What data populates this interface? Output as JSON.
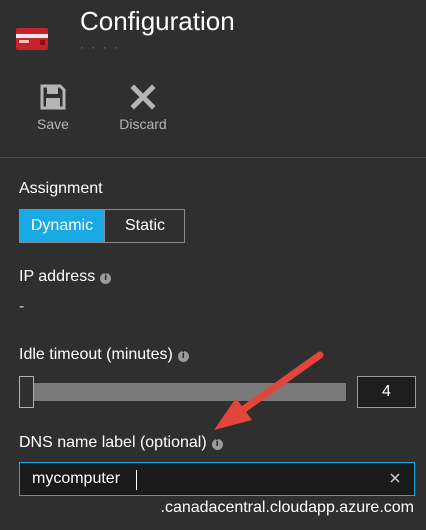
{
  "header": {
    "title": "Configuration",
    "subtitle": "· · · ·"
  },
  "toolbar": {
    "save_label": "Save",
    "discard_label": "Discard"
  },
  "assignment": {
    "label": "Assignment",
    "options": [
      "Dynamic",
      "Static"
    ],
    "selected": "Dynamic"
  },
  "ip_address": {
    "label": "IP address",
    "value": "-"
  },
  "idle_timeout": {
    "label": "Idle timeout (minutes)",
    "value": "4",
    "level": 0.0
  },
  "dns": {
    "label": "DNS name label (optional)",
    "value": "mycomputer",
    "suffix": ".canadacentral.cloudapp.azure.com"
  },
  "colors": {
    "background": "#2f2f2f",
    "accent": "#19a9e4",
    "arrow": "#e2463a"
  },
  "icons": [
    "app-icon",
    "save-icon",
    "discard-icon",
    "info-icon",
    "clear-icon"
  ]
}
